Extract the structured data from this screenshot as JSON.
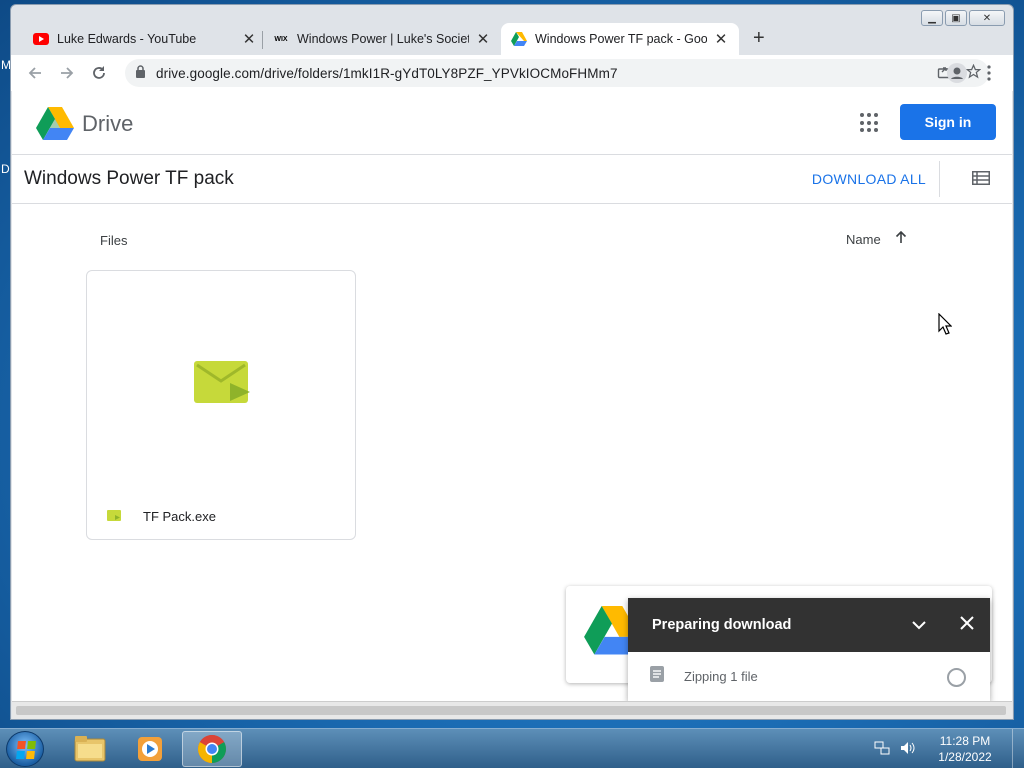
{
  "desktop": {
    "edge_letters": [
      "M",
      "D"
    ]
  },
  "window": {
    "controls": [
      "minimize",
      "maximize",
      "close"
    ]
  },
  "tabs": [
    {
      "label": "Luke Edwards - YouTube",
      "favicon": "youtube-icon",
      "active": false
    },
    {
      "label": "Windows Power | Luke's Society",
      "favicon": "wix-icon",
      "favicon_text": "WIX",
      "active": false
    },
    {
      "label": "Windows Power TF pack - Google Drive",
      "favicon": "google-drive-icon",
      "active": true
    }
  ],
  "toolbar": {
    "url": "drive.google.com/drive/folders/1mkI1R-gYdT0LY8PZF_YPVkIOCMoFHMm7"
  },
  "drive": {
    "brand": "Drive",
    "signin_label": "Sign in",
    "folder_title": "Windows Power TF pack",
    "download_all_label": "DOWNLOAD ALL",
    "files_label": "Files",
    "sort_label": "Name",
    "sort_direction": "ascending",
    "files": [
      {
        "name": "TF Pack.exe",
        "icon": "exe-file-icon"
      }
    ]
  },
  "download_panel": {
    "title": "Preparing download",
    "status": "Zipping 1 file"
  },
  "taskbar": {
    "pinned": [
      "windows-explorer-icon",
      "media-player-icon",
      "chrome-icon"
    ],
    "time": "11:28 PM",
    "date": "1/28/2022"
  },
  "colors": {
    "accent": "#1a73e8",
    "panel_header": "#323232",
    "file_icon": "#c6d93a"
  }
}
